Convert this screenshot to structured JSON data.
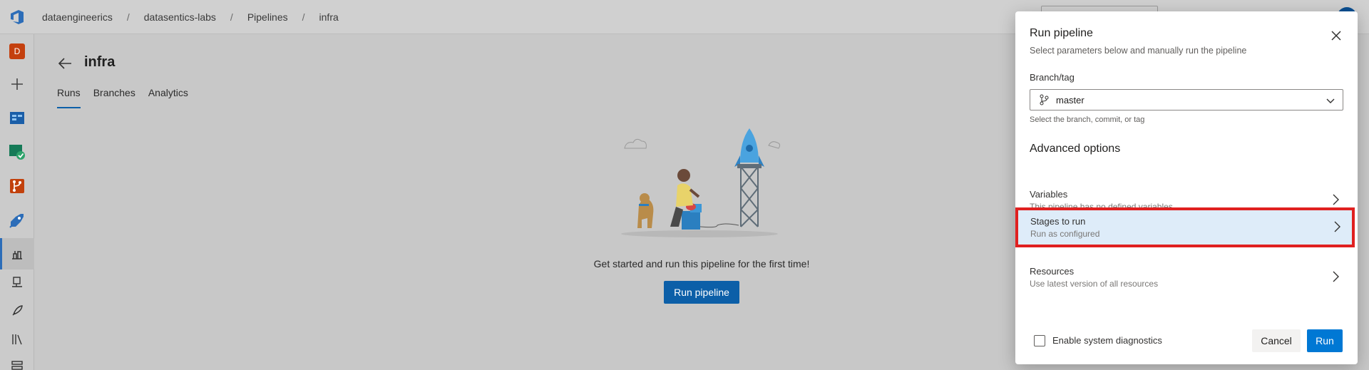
{
  "breadcrumb": [
    "dataengineerics",
    "datasentics-labs",
    "Pipelines",
    "infra"
  ],
  "breadcrumb_separator": "/",
  "org_avatar_letter": "D",
  "page": {
    "title": "infra",
    "tabs": [
      "Runs",
      "Branches",
      "Analytics"
    ],
    "active_tab": "Runs",
    "empty_state_text": "Get started and run this pipeline for the first time!",
    "run_button": "Run pipeline"
  },
  "panel": {
    "title": "Run pipeline",
    "subtitle": "Select parameters below and manually run the pipeline",
    "branch_label": "Branch/tag",
    "branch_value": "master",
    "branch_hint": "Select the branch, commit, or tag",
    "advanced_heading": "Advanced options",
    "options": [
      {
        "title": "Variables",
        "desc": "This pipeline has no defined variables"
      },
      {
        "title": "Stages to run",
        "desc": "Run as configured"
      },
      {
        "title": "Resources",
        "desc": "Use latest version of all resources"
      }
    ],
    "diagnostics_label": "Enable system diagnostics",
    "cancel": "Cancel",
    "run": "Run"
  },
  "colors": {
    "accent": "#0078d4",
    "highlight_border": "#e02020",
    "highlight_fill": "#deecf9"
  },
  "icons": [
    "azure-devops-logo-icon",
    "plus-icon",
    "boards-icon",
    "test-plans-icon",
    "repos-icon",
    "pipelines-icon",
    "builds-icon",
    "environments-icon",
    "releases-icon",
    "library-icon",
    "task-groups-icon",
    "back-arrow-icon",
    "close-icon",
    "branch-icon",
    "chevron-down-icon",
    "chevron-right-icon"
  ]
}
